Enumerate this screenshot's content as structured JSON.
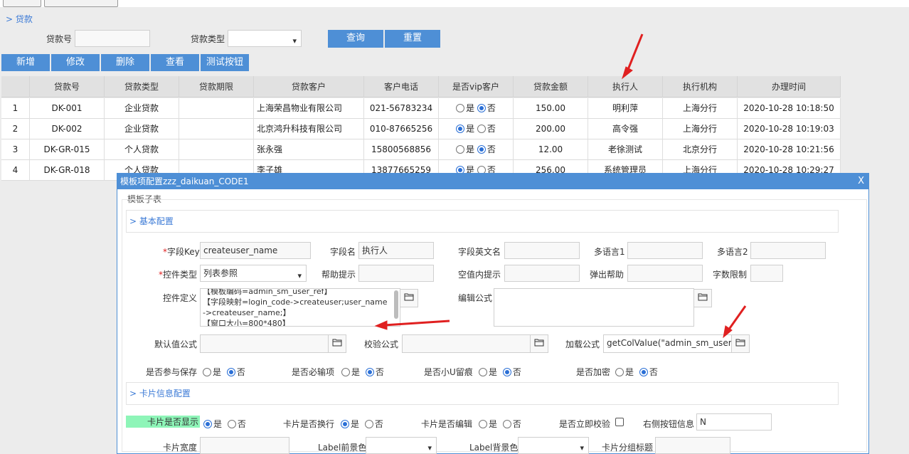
{
  "breadcrumb": "> 贷款",
  "search": {
    "loan_no_label": "贷款号",
    "loan_no_value": "",
    "loan_type_label": "贷款类型",
    "loan_type_value": "",
    "query_button": "查询",
    "reset_button": "重置"
  },
  "toolbar": {
    "add": "新增",
    "edit": "修改",
    "delete": "删除",
    "view": "查看",
    "test": "测试按钮"
  },
  "table": {
    "headers": [
      "",
      "贷款号",
      "贷款类型",
      "贷款期限",
      "贷款客户",
      "客户电话",
      "是否vip客户",
      "贷款金额",
      "执行人",
      "执行机构",
      "办理时间"
    ],
    "rows": [
      {
        "idx": "1",
        "no": "DK-001",
        "type": "企业贷款",
        "term": "",
        "customer": "上海荣昌物业有限公司",
        "phone": "021-56783234",
        "vip": "no",
        "amount": "150.00",
        "executor": "明利萍",
        "org": "上海分行",
        "time": "2020-10-28 10:18:50"
      },
      {
        "idx": "2",
        "no": "DK-002",
        "type": "企业贷款",
        "term": "",
        "customer": "北京鸿升科技有限公司",
        "phone": "010-87665256",
        "vip": "yes",
        "amount": "200.00",
        "executor": "高令强",
        "org": "上海分行",
        "time": "2020-10-28 10:19:03"
      },
      {
        "idx": "3",
        "no": "DK-GR-015",
        "type": "个人贷款",
        "term": "",
        "customer": "张永强",
        "phone": "15800568856",
        "vip": "no",
        "amount": "12.00",
        "executor": "老徐测试",
        "org": "北京分行",
        "time": "2020-10-28 10:21:56"
      },
      {
        "idx": "4",
        "no": "DK-GR-018",
        "type": "个人贷款",
        "term": "",
        "customer": "李子雄",
        "phone": "13877665259",
        "vip": "yes",
        "amount": "256.00",
        "executor": "系统管理员",
        "org": "上海分行",
        "time": "2020-10-28 10:29:27"
      }
    ],
    "yes": "是",
    "no": "否"
  },
  "dialog": {
    "title": "模板项配置zzz_daikuan_CODE1",
    "close": "X",
    "subtable_label": "模板子表",
    "basic_section": "> 基本配置",
    "card_section": "> 卡片信息配置",
    "field_key_label": "字段Key",
    "field_key_value": "createuser_name",
    "field_name_label": "字段名",
    "field_name_value": "执行人",
    "field_en_label": "字段英文名",
    "field_en_value": "",
    "lang1_label": "多语言1",
    "lang1_value": "",
    "lang2_label": "多语言2",
    "lang2_value": "",
    "control_type_label": "控件类型",
    "control_type_value": "列表参照",
    "help_tip_label": "帮助提示",
    "help_tip_value": "",
    "empty_tip_label": "空值内提示",
    "empty_tip_value": "",
    "popup_help_label": "弹出帮助",
    "popup_help_value": "",
    "char_limit_label": "字数限制",
    "char_limit_value": "",
    "control_def_label": "控件定义",
    "control_def_line1": "【模板编码=admin_sm_user_ref】",
    "control_def_line2": "【字段映射=login_code->createuser;user_name->createuser_name;】",
    "control_def_line3": "【窗口大小=800*480】",
    "edit_formula_label": "编辑公式",
    "edit_formula_value": "",
    "default_formula_label": "默认值公式",
    "default_formula_value": "",
    "validate_formula_label": "校验公式",
    "validate_formula_value": "",
    "load_formula_label": "加载公式",
    "load_formula_value": "getColValue(\"admin_sm_user\",\"u",
    "save_label": "是否参与保存",
    "required_label": "是否必输项",
    "trace_label": "是否小U留痕",
    "encrypt_label": "是否加密",
    "card_show_label": "卡片是否显示",
    "card_wrap_label": "卡片是否换行",
    "card_edit_label": "卡片是否编辑",
    "instant_validate_label": "是否立即校验",
    "right_btn_label": "右侧按钮信息",
    "right_btn_value": "N",
    "card_width_label": "卡片宽度",
    "card_width_value": "",
    "label_fg_label": "Label前景色",
    "label_fg_value": "",
    "label_bg_label": "Label背景色",
    "label_bg_value": "",
    "card_group_label": "卡片分组标题",
    "card_group_value": "",
    "yes": "是",
    "no": "否",
    "required_mark": "*"
  },
  "colors": {
    "accent": "#4e8fd6",
    "arrow": "#e02020",
    "highlight": "#8ef5b8"
  }
}
